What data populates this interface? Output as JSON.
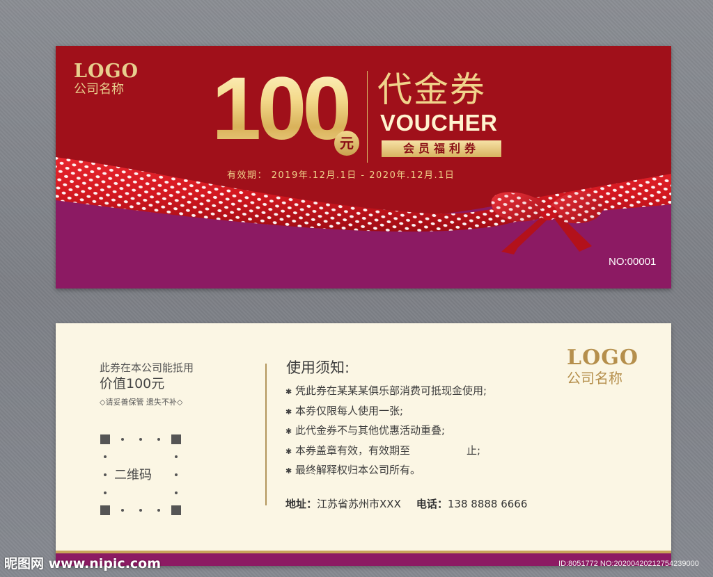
{
  "front": {
    "logo": "LOGO",
    "company": "公司名称",
    "amount": "100",
    "currency": "元",
    "title_cn": "代金券",
    "title_en": "VOUCHER",
    "badge": "会员福利券",
    "validity": "有效期： 2019年.12月.1日 - 2020年.12月.1日",
    "serial": "NO:00001",
    "colors": {
      "red": "#a0101a",
      "purple": "#8c1a63",
      "gold": "#e8cf8e"
    }
  },
  "back": {
    "deduct_text": "此券在本公司能抵用",
    "value_text": "价值100元",
    "keep_text": "◇请妥善保管 遗失不补◇",
    "qr_label": "二维码",
    "notice_title": "使用须知:",
    "rules": [
      "凭此券在某某某俱乐部消费可抵现金使用;",
      "本券仅限每人使用一张;",
      "此代金券不与其他优惠活动重叠;",
      "本券盖章有效，有效期至                 止;",
      "最终解释权归本公司所有。"
    ],
    "bullet": "✱",
    "address_label": "地址：",
    "address": "江苏省苏州市XXX",
    "phone_label": "电话：",
    "phone": "138 8888 6666",
    "logo": "LOGO",
    "company": "公司名称"
  },
  "watermark": {
    "site": "昵图网 www.nipic.com",
    "id": "ID:8051772 NO:20200420212754239000"
  }
}
